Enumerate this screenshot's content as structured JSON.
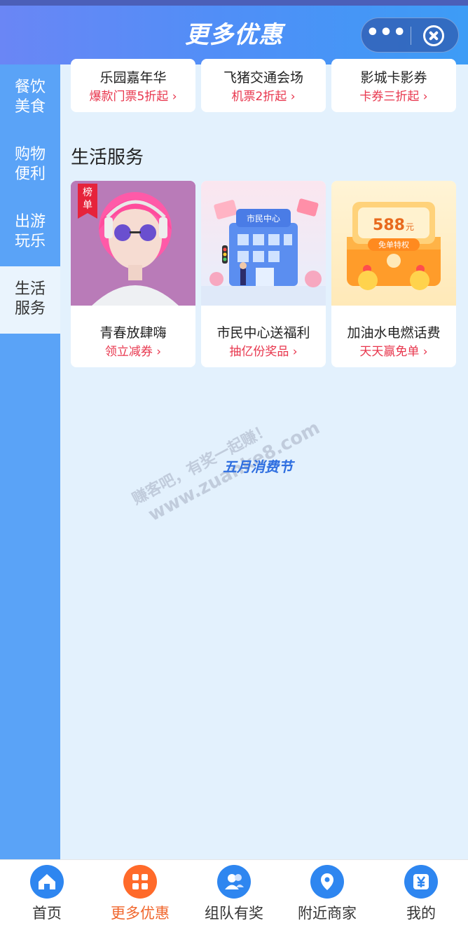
{
  "header": {
    "title": "更多优惠"
  },
  "sidebar": {
    "items": [
      {
        "line1": "餐饮",
        "line2": "美食"
      },
      {
        "line1": "购物",
        "line2": "便利"
      },
      {
        "line1": "出游",
        "line2": "玩乐"
      },
      {
        "line1": "生活",
        "line2": "服务"
      }
    ],
    "active_index": 3
  },
  "top_row": [
    {
      "title": "乐园嘉年华",
      "sub": "爆款门票5折起 ›"
    },
    {
      "title": "飞猪交通会场",
      "sub": "机票2折起 ›"
    },
    {
      "title": "影城卡影券",
      "sub": "卡券三折起 ›"
    }
  ],
  "section": {
    "title": "生活服务",
    "cards": [
      {
        "badge_line1": "榜",
        "badge_line2": "单",
        "title": "青春放肆嗨",
        "sub": "领立减券 ›"
      },
      {
        "image_text": "市民中心",
        "title": "市民中心送福利",
        "sub": "抽亿份奖品 ›"
      },
      {
        "image_amount": "588",
        "image_unit": "元",
        "image_caption": "免单特权",
        "title": "加油水电燃话费",
        "sub": "天天赢免单 ›"
      }
    ]
  },
  "overlay": {
    "watermark_line1": "赚客吧，有奖一起赚！",
    "watermark_line2": "www.zuanke8.com",
    "festival": "五月消费节"
  },
  "tabbar": {
    "tabs": [
      {
        "label": "首页",
        "icon": "home-icon"
      },
      {
        "label": "更多优惠",
        "icon": "grid-icon"
      },
      {
        "label": "组队有奖",
        "icon": "team-icon"
      },
      {
        "label": "附近商家",
        "icon": "location-icon"
      },
      {
        "label": "我的",
        "icon": "yen-icon"
      }
    ],
    "active_index": 1
  },
  "colors": {
    "accent": "#f0662c",
    "sidebar": "#5aa3f7",
    "price_red": "#e8364d",
    "header_blue": "#4f8ff7"
  }
}
